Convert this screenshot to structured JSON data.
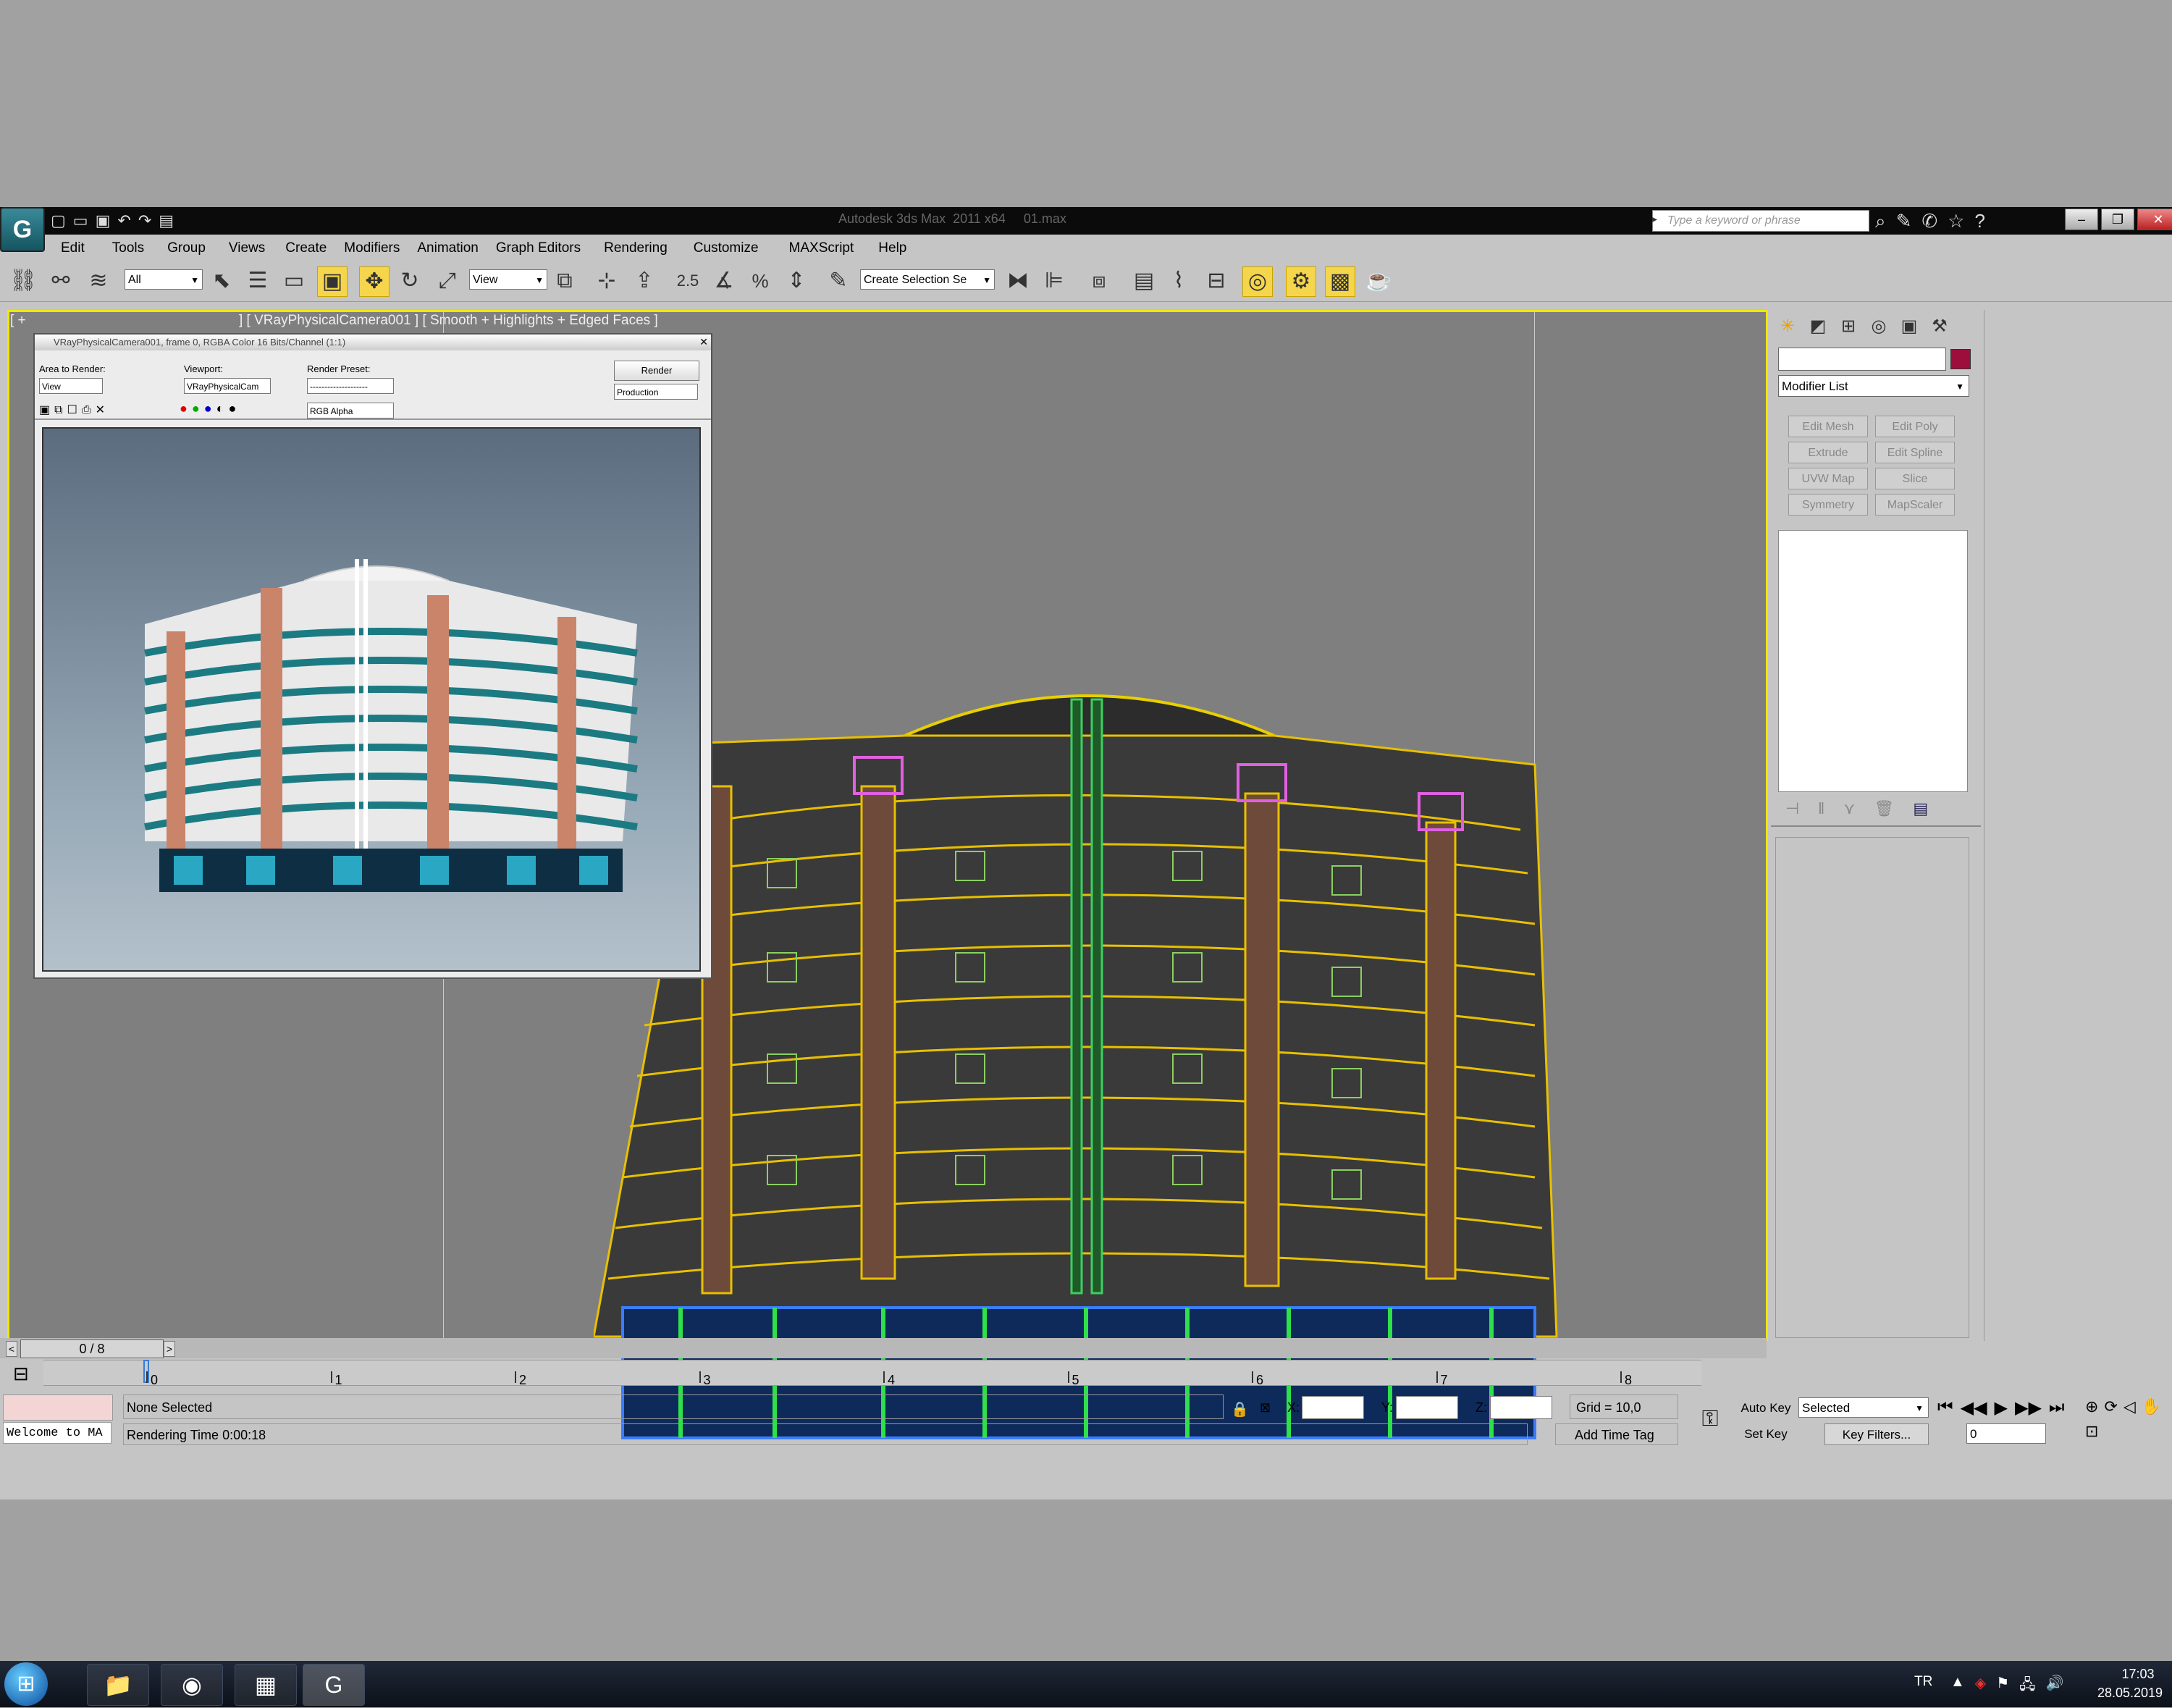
{
  "titlebar": {
    "window_title": "Autodesk 3ds Max  2011 x64     01.max",
    "search_placeholder": "Type a keyword or phrase",
    "app_logo": "3ds-max-logo"
  },
  "menu": [
    "Edit",
    "Tools",
    "Group",
    "Views",
    "Create",
    "Modifiers",
    "Animation",
    "Graph Editors",
    "Rendering",
    "Customize",
    "MAXScript",
    "Help"
  ],
  "toolbar": {
    "selection_filter": "All",
    "reference_coord": "View",
    "named_selection": "Create Selection Se"
  },
  "viewport": {
    "label_prefix": "[ +",
    "label": "] [ VRayPhysicalCamera001 ] [ Smooth + Highlights + Edged Faces ]"
  },
  "render_window": {
    "title": "VRayPhysicalCamera001, frame 0, RGBA Color 16 Bits/Channel (1:1)",
    "area_label": "Area to Render:",
    "area_value": "View",
    "viewport_label": "Viewport:",
    "viewport_value": "VRayPhysicalCam",
    "preset_label": "Render Preset:",
    "preset_value": "--------------------",
    "render_button": "Render",
    "production_value": "Production",
    "channel_value": "RGB Alpha"
  },
  "command_panel": {
    "modifier_list": "Modifier List",
    "modifier_buttons": [
      "Edit Mesh",
      "Edit Poly",
      "Extrude",
      "Edit Spline",
      "UVW Map",
      "Slice",
      "Symmetry",
      "MapScaler"
    ],
    "object_color": "#9d0e3d"
  },
  "timeline": {
    "slider_label": "0 / 8",
    "ticks": [
      "0",
      "1",
      "2",
      "3",
      "4",
      "5",
      "6",
      "7",
      "8"
    ]
  },
  "status": {
    "listener_text": "Welcome to MA",
    "selection_text": "None Selected",
    "prompt_text": "Rendering Time  0:00:18",
    "x_label": "X:",
    "y_label": "Y:",
    "z_label": "Z:",
    "grid_text": "Grid = 10,0",
    "add_time_tag": "Add Time Tag",
    "auto_key": "Auto Key",
    "set_key": "Set Key",
    "auto_key_mode": "Selected",
    "key_filters": "Key Filters...",
    "frame_value": "0"
  },
  "taskbar": {
    "language": "TR",
    "time": "17:03",
    "date": "28.05.2019"
  }
}
